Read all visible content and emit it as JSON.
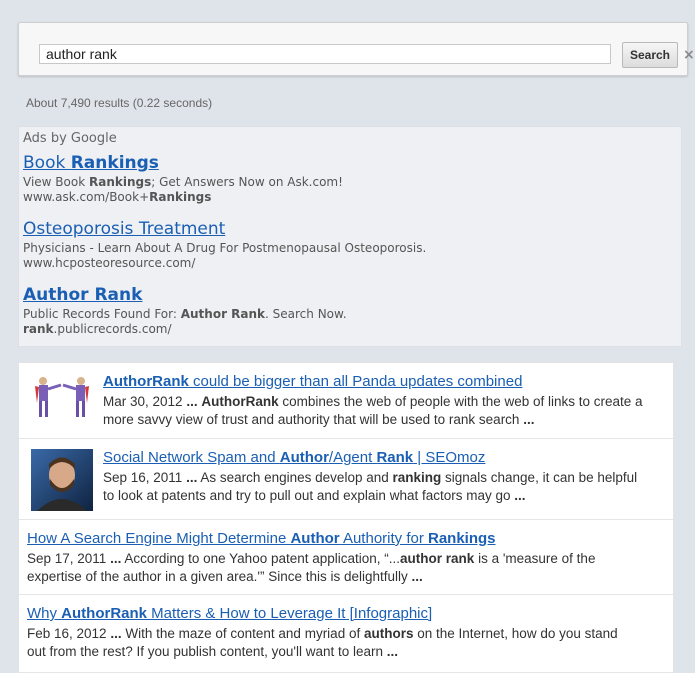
{
  "search": {
    "query": "author rank",
    "button_label": "Search",
    "close_glyph": "×"
  },
  "stats": "About 7,490 results (0.22 seconds)",
  "ads": {
    "label": "Ads by Google",
    "items": [
      {
        "title_parts": [
          "Book ",
          "Rankings"
        ],
        "desc_parts": [
          "View Book ",
          "Rankings",
          "; Get Answers Now on Ask.com!"
        ],
        "url_parts": [
          "www.ask.com/Book+",
          "Rankings"
        ]
      },
      {
        "title_parts": [
          "Osteoporosis Treatment"
        ],
        "desc_parts": [
          "Physicians - Learn About A Drug For Postmenopausal Osteoporosis."
        ],
        "url_parts": [
          "www.hcposteoresource.com/"
        ]
      },
      {
        "title_parts": [
          "Author Rank"
        ],
        "desc_parts": [
          "Public Records Found For: ",
          "Author Rank",
          ". Search Now."
        ],
        "url_parts": [
          "rank",
          ".publicrecords.com/"
        ]
      }
    ]
  },
  "results": [
    {
      "thumbnail": "superhero-cartoon-icon",
      "title_parts": [
        "AuthorRank",
        " could be bigger than all Panda updates combined"
      ],
      "line1_parts": [
        "Mar 30, 2012 ",
        "...",
        " ",
        "AuthorRank",
        " combines the web of people with the web of links to create a"
      ],
      "line2_parts": [
        "more savvy view of trust and authority that will be used to rank search ",
        "..."
      ]
    },
    {
      "thumbnail": "person-photo-icon",
      "title_parts": [
        "Social Network Spam and ",
        "Author",
        "/Agent ",
        "Rank",
        " | SEOmoz"
      ],
      "line1_parts": [
        "Sep 16, 2011 ",
        "...",
        " As search engines develop and ",
        "ranking",
        " signals change, it can be helpful"
      ],
      "line2_parts": [
        "to look at patents and try to pull out and explain what factors may go ",
        "..."
      ]
    },
    {
      "thumbnail": "",
      "title_parts": [
        "How A Search Engine Might Determine ",
        "Author",
        " Authority for ",
        "Rankings"
      ],
      "line1_parts": [
        "Sep 17, 2011 ",
        "...",
        " According to one Yahoo patent application, “...",
        "author rank",
        " is a 'measure of the"
      ],
      "line2_parts": [
        "expertise of the author in a given area.'” Since this is delightfully ",
        "..."
      ]
    },
    {
      "thumbnail": "",
      "title_parts": [
        "Why ",
        "AuthorRank",
        " Matters & How to Leverage It [Infographic]"
      ],
      "line1_parts": [
        "Feb 16, 2012 ",
        "...",
        " With the maze of content and myriad of ",
        "authors",
        " on the Internet, how do you stand"
      ],
      "line2_parts": [
        "out from the rest? If you publish content, you'll want to learn ",
        "..."
      ]
    }
  ],
  "colors": {
    "link": "#1a5fb4",
    "background": "#dfe3ea",
    "ads_background": "#eef0f3"
  }
}
